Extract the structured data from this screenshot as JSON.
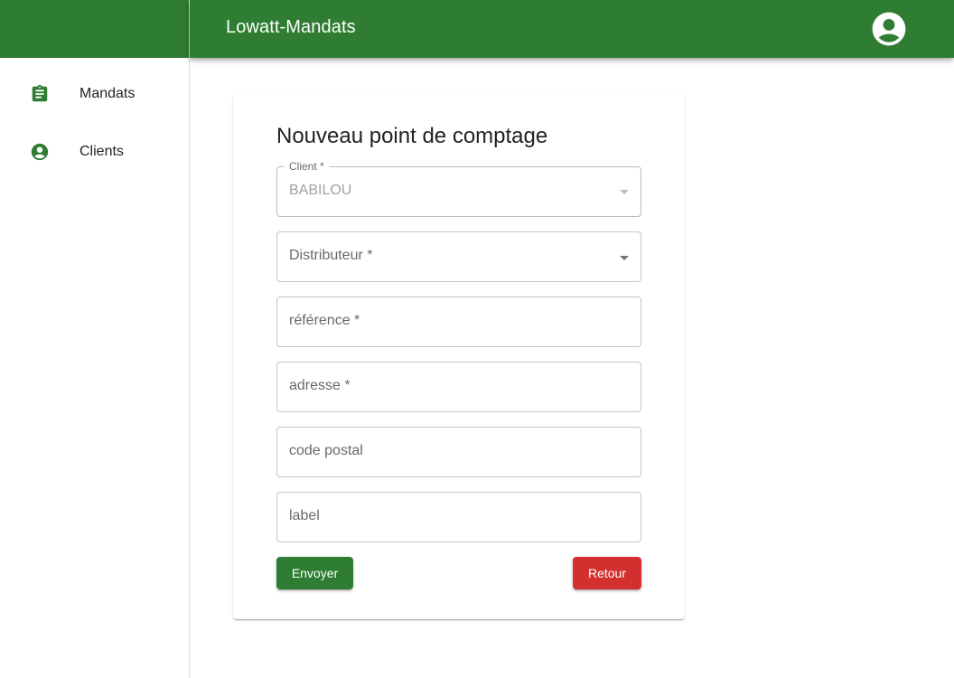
{
  "app": {
    "title": "Lowatt-Mandats"
  },
  "colors": {
    "primary": "#2e7d32",
    "danger": "#d32f2f"
  },
  "sidebar": {
    "items": [
      {
        "label": "Mandats",
        "icon": "clipboard-icon"
      },
      {
        "label": "Clients",
        "icon": "account-circle-icon"
      }
    ]
  },
  "header": {
    "avatar_icon": "account-circle-icon"
  },
  "form": {
    "title": "Nouveau point de comptage",
    "client": {
      "label": "Client *",
      "value": "BABILOU"
    },
    "distributeur": {
      "label": "Distributeur *"
    },
    "reference": {
      "label": "référence *"
    },
    "adresse": {
      "label": "adresse *"
    },
    "code_postal": {
      "label": "code postal"
    },
    "label": {
      "label": "label"
    },
    "send_label": "Envoyer",
    "back_label": "Retour"
  }
}
